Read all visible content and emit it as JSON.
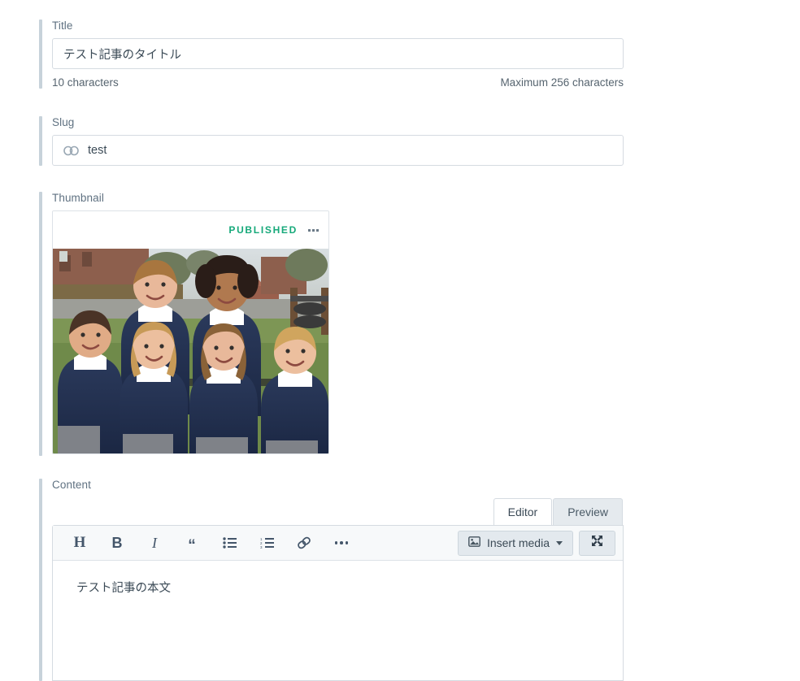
{
  "form": {
    "title_field": {
      "label": "Title",
      "value": "テスト記事のタイトル",
      "char_count": "10 characters",
      "max_hint": "Maximum 256 characters"
    },
    "slug_field": {
      "label": "Slug",
      "value": "test",
      "icon": "link-icon"
    },
    "thumbnail_field": {
      "label": "Thumbnail",
      "status_badge": "PUBLISHED",
      "status_color": "#16a97a",
      "menu_icon": "kebab-menu-icon",
      "image_alt": "Six schoolchildren in navy uniforms smiling on a playground"
    },
    "content_field": {
      "label": "Content",
      "tabs": [
        {
          "label": "Editor",
          "active": true
        },
        {
          "label": "Preview",
          "active": false
        }
      ],
      "toolbar": [
        {
          "name": "heading-button",
          "glyph": "H"
        },
        {
          "name": "bold-button",
          "glyph": "B"
        },
        {
          "name": "italic-button",
          "glyph": "I"
        },
        {
          "name": "blockquote-button",
          "glyph": "“"
        },
        {
          "name": "bullet-list-button",
          "glyph": ""
        },
        {
          "name": "numbered-list-button",
          "glyph": ""
        },
        {
          "name": "link-button",
          "glyph": ""
        },
        {
          "name": "more-options-button",
          "glyph": ""
        }
      ],
      "insert_media_label": "Insert media",
      "insert_media_icon": "image-icon",
      "expand_icon": "fullscreen-icon",
      "body_text": "テスト記事の本文"
    }
  },
  "theme": {
    "rail": "#c7d2da",
    "label": "#5f7181",
    "border": "#d5dbe1",
    "text": "#3b4a56",
    "toolbar_bg": "#f7f9fa",
    "button_bg": "#e3e9ee"
  }
}
